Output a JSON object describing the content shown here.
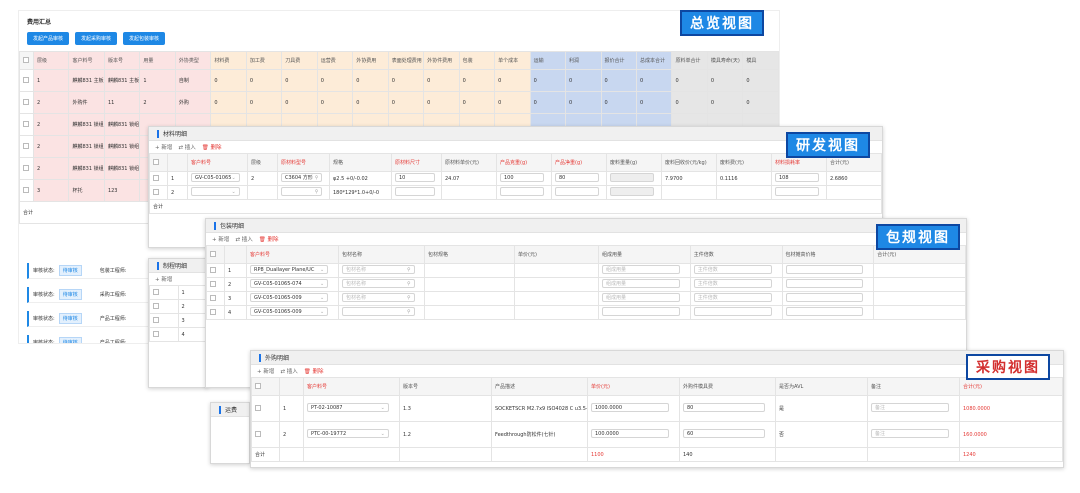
{
  "badges": {
    "overview": "总览视图",
    "rnd": "研发视图",
    "pack": "包规视图",
    "purchase": "采购视图"
  },
  "overview": {
    "title": "费用汇总",
    "buttons": [
      "发起产品审核",
      "发起采购审核",
      "发起包装审核"
    ],
    "headers": [
      "",
      "层级",
      "客户料号",
      "版本号",
      "用量",
      "外协类型",
      "材料费",
      "加工费",
      "刀具费",
      "运营费",
      "外协费用",
      "表面处理费用",
      "外协件费用",
      "包装",
      "单个成本",
      "运输",
      "利润",
      "报价合计",
      "总成本合计",
      "原料单合计",
      "模具寿命(天)",
      "模具"
    ],
    "rows": [
      [
        "",
        "1",
        "麒麟831 主板1",
        "麒麟831 主板1",
        "1",
        "自制",
        "0",
        "0",
        "0",
        "0",
        "0",
        "0",
        "0",
        "0",
        "0",
        "0",
        "0",
        "0",
        "0",
        "0",
        "0",
        "0"
      ],
      [
        "",
        "2",
        "外购件",
        "11",
        "2",
        "外购",
        "0",
        "0",
        "0",
        "0",
        "0",
        "0",
        "0",
        "0",
        "0",
        "0",
        "0",
        "0",
        "0",
        "0",
        "0",
        "0"
      ],
      [
        "",
        "2",
        "麒麟831 锁组1",
        "麒麟831 锁组1",
        "",
        "",
        "",
        "",
        "",
        "",
        "",
        "",
        "",
        "",
        "",
        "",
        "",
        "",
        "",
        "",
        "",
        ""
      ],
      [
        "",
        "2",
        "麒麟831 锁组1",
        "麒麟831 锁组1",
        "",
        "",
        "",
        "",
        "",
        "",
        "",
        "",
        "",
        "",
        "",
        "",
        "",
        "",
        "",
        "",
        "",
        ""
      ],
      [
        "",
        "2",
        "麒麟831 锁组1",
        "麒麟831 锁组1",
        "",
        "",
        "",
        "",
        "",
        "",
        "",
        "",
        "",
        "",
        "",
        "",
        "",
        "",
        "",
        "",
        "",
        ""
      ],
      [
        "",
        "3",
        "杯托",
        "123",
        "",
        "",
        "",
        "",
        "",
        "",
        "",
        "",
        "",
        "",
        "",
        "",
        "",
        "",
        "",
        "",
        "",
        ""
      ]
    ],
    "total_label": "合计",
    "status": [
      {
        "label": "审核状态:",
        "tag": "待审核",
        "role": "包装工程师:"
      },
      {
        "label": "审核状态:",
        "tag": "待审核",
        "role": "采购工程师:"
      },
      {
        "label": "审核状态:",
        "tag": "待审核",
        "role": "产品工程师:"
      },
      {
        "label": "审核状态:",
        "tag": "待审核",
        "role": "产品工程师:"
      }
    ]
  },
  "toolbar": {
    "add": "+ 新增",
    "insert": "⇄ 插入",
    "delete": "🗑 删除"
  },
  "rnd": {
    "title": "材料明细",
    "headers": [
      "",
      "",
      "客户料号",
      "层级",
      "原材料型号",
      "规格",
      "原材料尺寸",
      "原材料单价(元)",
      "产品克重(g)",
      "产品净重(g)",
      "废料重量(g)",
      "废料回收价(元/kg)",
      "废料费(元)",
      "材料损耗率",
      "合计(元)"
    ],
    "rows": [
      [
        "",
        "1",
        "GV-C05-01065",
        "2",
        "C3604 方形",
        "φ2.5 +0/-0.02",
        "10",
        "24.07",
        "100",
        "80",
        "",
        "7.9700",
        "0.1116",
        "108",
        "2.6860"
      ],
      [
        "",
        "2",
        "",
        "",
        "",
        "180*129*1.0+0/-0",
        "",
        "",
        "",
        "",
        "",
        "",
        "",
        "",
        ""
      ]
    ],
    "total_label": "合计"
  },
  "pack": {
    "title": "包装明细",
    "headers": [
      "",
      "",
      "客户料号",
      "包材名称",
      "包材规格",
      "单价(元)",
      "组成用量",
      "主件倍数",
      "包材摊高价格",
      "合计(元)"
    ],
    "rows": [
      [
        "",
        "1",
        "RP8_Duallayer Plane/UC",
        "包材名称",
        "",
        "",
        "组成用量",
        "主件倍数",
        "",
        ""
      ],
      [
        "",
        "2",
        "GV-C05-01065-074",
        "包材名称",
        "",
        "",
        "组成用量",
        "主件倍数",
        "",
        ""
      ],
      [
        "",
        "3",
        "GV-C05-01065-009",
        "包材名称",
        "",
        "",
        "组成用量",
        "主件倍数",
        "",
        ""
      ],
      [
        "",
        "4",
        "GV-C05-01065-009",
        "",
        "",
        "",
        "",
        "",
        "",
        ""
      ]
    ]
  },
  "proc": {
    "title": "制程明细",
    "rows": [
      "1",
      "2",
      "3",
      "4"
    ]
  },
  "ship": {
    "title": "运费",
    "cols": [
      "运"
    ]
  },
  "purchase": {
    "title": "外购明细",
    "headers": [
      "",
      "",
      "客户料号",
      "版本号",
      "产品描述",
      "单价(元)",
      "外购件模具费",
      "是否为AVL",
      "备注",
      "合计(元)"
    ],
    "rows": [
      [
        "",
        "1",
        "PT-02-10087",
        "1.3",
        "SOCKETSCR M2.7x9 ISO4028 C u3.5-8.5umWAX",
        "1000.0000",
        "80",
        "是",
        "备注",
        "1080.0000"
      ],
      [
        "",
        "2",
        "PTC-00-19772",
        "1.2",
        "Feedthrough防松件(七针)",
        "100.0000",
        "60",
        "否",
        "备注",
        "160.0000"
      ]
    ],
    "total": {
      "label": "合计",
      "price": "1100",
      "mold": "140",
      "sum": "1240"
    }
  }
}
